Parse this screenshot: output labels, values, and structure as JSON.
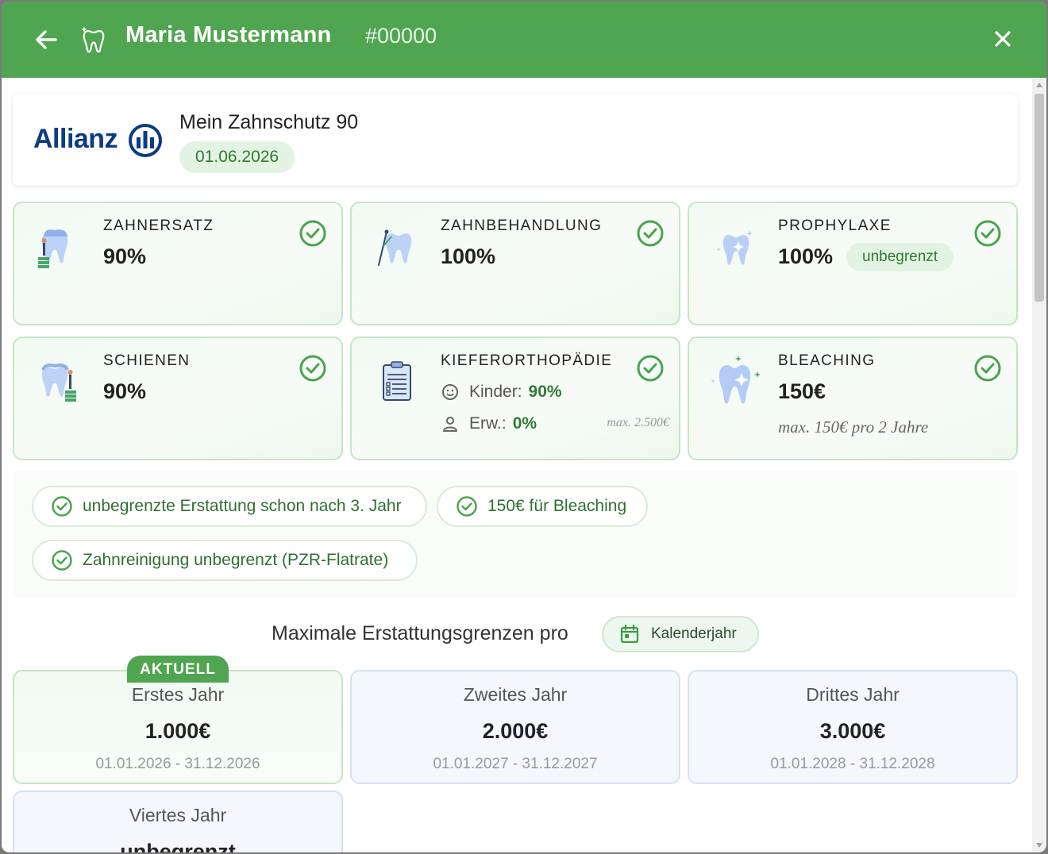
{
  "header": {
    "patient_name": "Maria Mustermann",
    "patient_id": "#00000"
  },
  "tariff": {
    "insurer_logo": "Allianz",
    "name": "Mein Zahnschutz 90",
    "start_date": "01.06.2026"
  },
  "benefits": [
    {
      "title": "ZAHNERSATZ",
      "value": "90%",
      "icon": "tooth-crown-icon"
    },
    {
      "title": "ZAHNBEHANDLUNG",
      "value": "100%",
      "icon": "tooth-treatment-icon"
    },
    {
      "title": "PROPHYLAXE",
      "value": "100%",
      "badge": "unbegrenzt",
      "icon": "tooth-sparkle-icon"
    },
    {
      "title": "SCHIENEN",
      "value": "90%",
      "icon": "tooth-splint-icon"
    },
    {
      "title": "KIEFERORTHOPÄDIE",
      "kinder_label": "Kinder:",
      "kinder_value": "90%",
      "erw_label": "Erw.:",
      "erw_value": "0%",
      "max": "max. 2.500€",
      "icon": "clipboard-icon"
    },
    {
      "title": "BLEACHING",
      "value": "150€",
      "note": "max. 150€ pro 2 Jahre",
      "icon": "tooth-bleaching-icon"
    }
  ],
  "features": [
    "unbegrenzte Erstattung schon nach 3. Jahr",
    "150€ für Bleaching",
    "Zahnreinigung unbegrenzt (PZR-Flatrate)"
  ],
  "limits": {
    "heading": "Maximale Erstattungsgrenzen pro",
    "period_button": "Kalenderjahr",
    "current_badge": "AKTUELL",
    "years": [
      {
        "name": "Erstes Jahr",
        "value": "1.000€",
        "range": "01.01.2026 - 31.12.2026",
        "active": true
      },
      {
        "name": "Zweites Jahr",
        "value": "2.000€",
        "range": "01.01.2027 - 31.12.2027",
        "active": false
      },
      {
        "name": "Drittes Jahr",
        "value": "3.000€",
        "range": "01.01.2028 - 31.12.2028",
        "active": false
      },
      {
        "name": "Viertes Jahr",
        "value": "unbegrenzt",
        "range": "",
        "active": false
      }
    ]
  },
  "colors": {
    "header_green": "#50a550",
    "accent_green": "#2f7a32",
    "allianz_blue": "#0a3b86",
    "tooth_blue": "#a9c4f0"
  }
}
